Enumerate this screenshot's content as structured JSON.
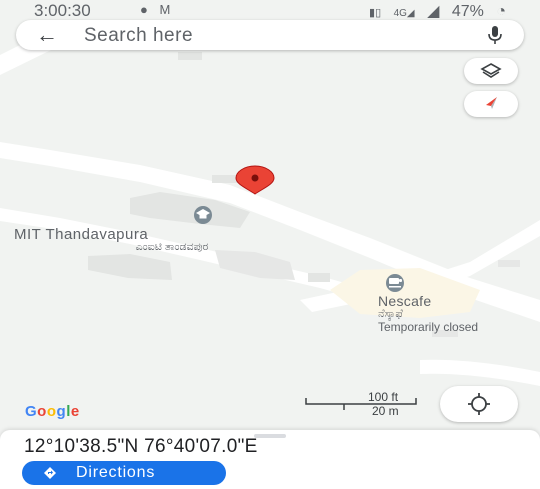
{
  "status_bar": {
    "time": "3:00:30",
    "notification_icons": [
      "chat-bubble-icon",
      "gmail-icon"
    ],
    "system_icons": [
      "vibrate-icon",
      "4g-signal-icon",
      "cell-signal-icon"
    ],
    "battery_percent": "47%"
  },
  "search": {
    "placeholder": "Search here"
  },
  "map": {
    "places": [
      {
        "name": "MIT Thandavapura",
        "name_local": "ಎಂಐಟಿ ತಾಂಡವಪುರ",
        "icon": "school-icon"
      },
      {
        "name": "Nescafe",
        "name_local": "ನೆಸ್ಕಾಫೆ",
        "status": "Temporarily closed",
        "icon": "cafe-icon"
      }
    ],
    "scale": {
      "imperial": "100 ft",
      "metric": "20 m"
    },
    "logo": "Google",
    "pin_color": "#ea4335"
  },
  "bottom_sheet": {
    "coordinates": "12°10'38.5\"N 76°40'07.0\"E",
    "directions_label": "Directions",
    "accent": "#1a73e8"
  }
}
